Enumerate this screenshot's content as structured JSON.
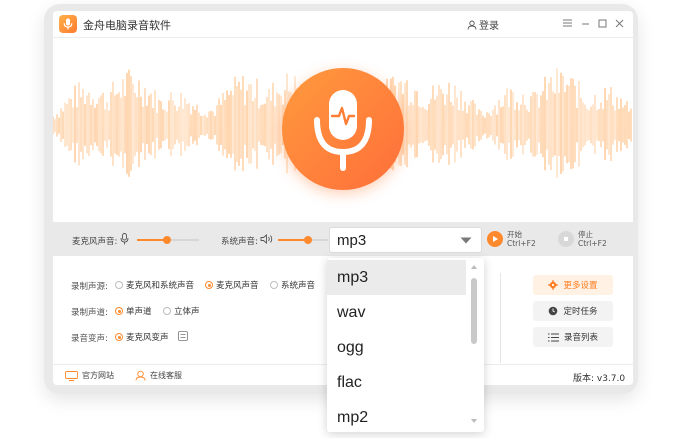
{
  "app": {
    "title": "金舟电脑录音软件",
    "login_label": "登录"
  },
  "volume": {
    "mic_label": "麦克风声音:",
    "mic_level": 0.48,
    "system_label": "系统声音:",
    "system_level": 0.6
  },
  "controls": {
    "start_label": "开始",
    "start_shortcut": "Ctrl+F2",
    "stop_label": "停止",
    "stop_shortcut": "Ctrl+F2"
  },
  "options": {
    "source_label": "录制声源:",
    "source_options": [
      "麦克风和系统声音",
      "麦克风声音",
      "系统声音"
    ],
    "source_selected": 1,
    "channel_label": "录制声道:",
    "channel_options": [
      "单声道",
      "立体声"
    ],
    "channel_selected": 0,
    "effect_label": "录音变声:",
    "effect_option": "麦克风变声"
  },
  "format": {
    "selected": "mp3",
    "options": [
      "mp3",
      "wav",
      "ogg",
      "flac",
      "mp2"
    ]
  },
  "side_buttons": [
    "更多设置",
    "定时任务",
    "录音列表"
  ],
  "footer": {
    "website_label": "官方网站",
    "service_label": "在线客服",
    "version": "版本: v3.7.0"
  },
  "colors": {
    "accent": "#ff8a2e",
    "wave": "#ffc58f"
  }
}
